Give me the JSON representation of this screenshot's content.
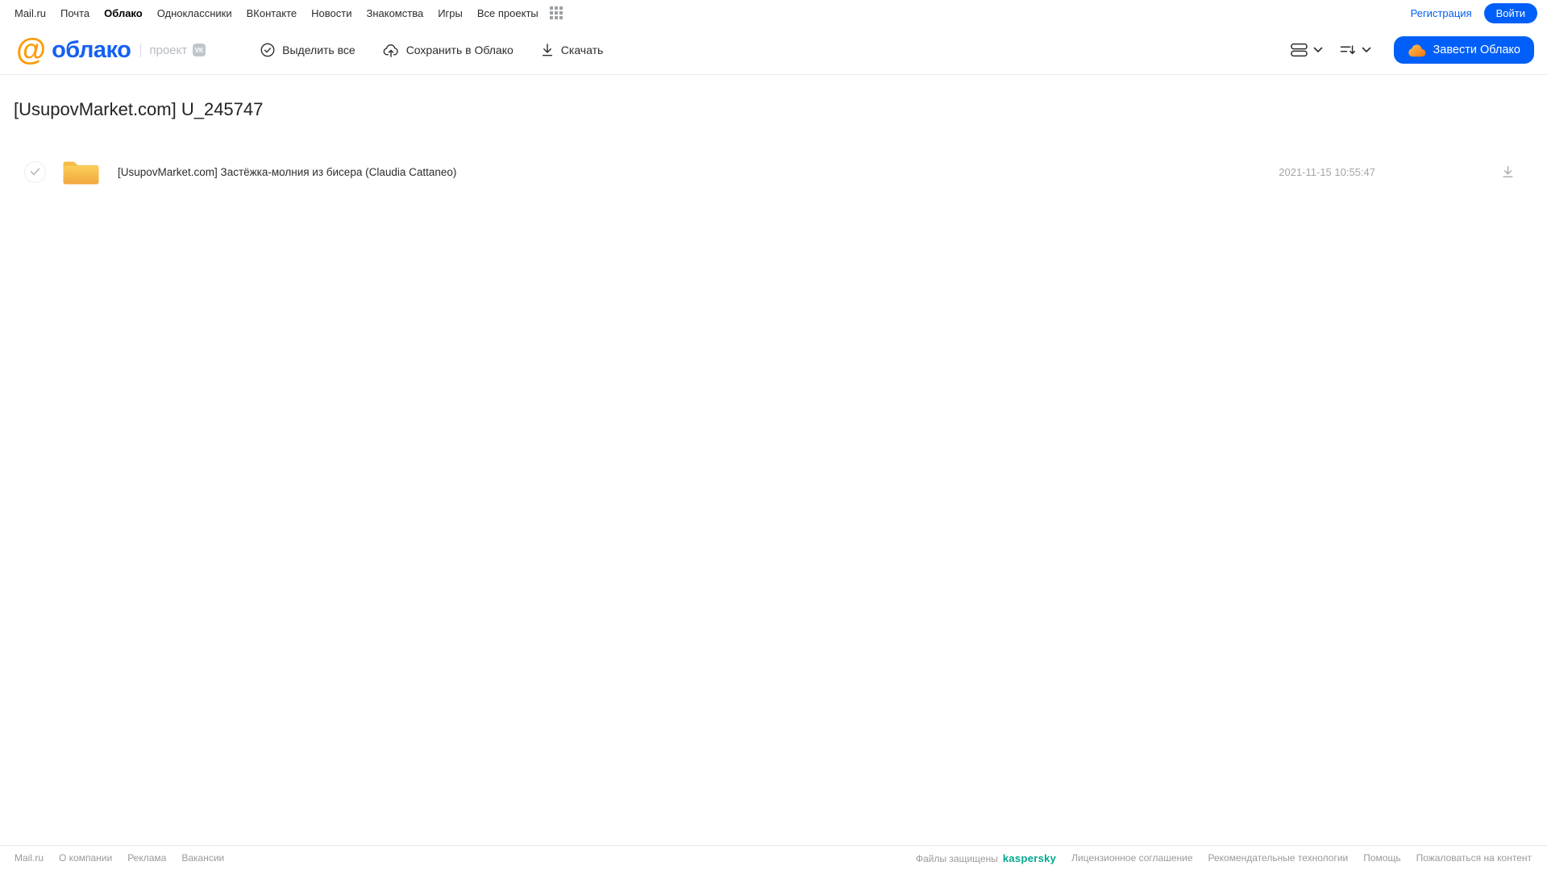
{
  "top_nav": {
    "links": [
      "Mail.ru",
      "Почта",
      "Облако",
      "Одноклассники",
      "ВКонтакте",
      "Новости",
      "Знакомства",
      "Игры",
      "Все проекты"
    ],
    "active_link": "Облако",
    "register_label": "Регистрация",
    "login_label": "Войти"
  },
  "header": {
    "logo": {
      "at_symbol": "@",
      "brand": "облако",
      "project_label": "проект",
      "vk_badge": "VK"
    },
    "toolbar": [
      {
        "label": "Выделить все",
        "icon": "check-circle-icon"
      },
      {
        "label": "Сохранить в Облако",
        "icon": "cloud-upload-icon"
      },
      {
        "label": "Скачать",
        "icon": "download-icon"
      }
    ],
    "view_controls": [
      {
        "icon": "list-view-icon",
        "dropdown_icon": "chevron-down-icon"
      },
      {
        "icon": "sort-icon",
        "dropdown_icon": "chevron-down-icon"
      }
    ],
    "create_cloud_button": {
      "label": "Завести Облако",
      "icon": "orange-cloud-icon"
    }
  },
  "main": {
    "title": "[UsupovMarket.com] U_245747",
    "files": [
      {
        "type": "folder",
        "name": "[UsupovMarket.com] Застёжка-молния из бисера (Claudia Cattaneo)",
        "date": "2021-11-15 10:55:47",
        "selected": false
      }
    ]
  },
  "footer": {
    "left_links": [
      "Mail.ru",
      "О компании",
      "Реклама",
      "Вакансии"
    ],
    "protection_label": "Файлы защищены",
    "kaspersky_label": "kaspersky",
    "right_links": [
      "Лицензионное соглашение",
      "Рекомендательные технологии",
      "Помощь",
      "Пожаловаться на контент"
    ]
  },
  "colors": {
    "accent_blue": "#005ff9",
    "logo_orange": "#fc9c0c",
    "folder_yellow_top": "#fbce58",
    "folder_yellow_bottom": "#f0a73d",
    "kaspersky_teal": "#00a88e",
    "muted_gray": "#a5a5a5"
  }
}
